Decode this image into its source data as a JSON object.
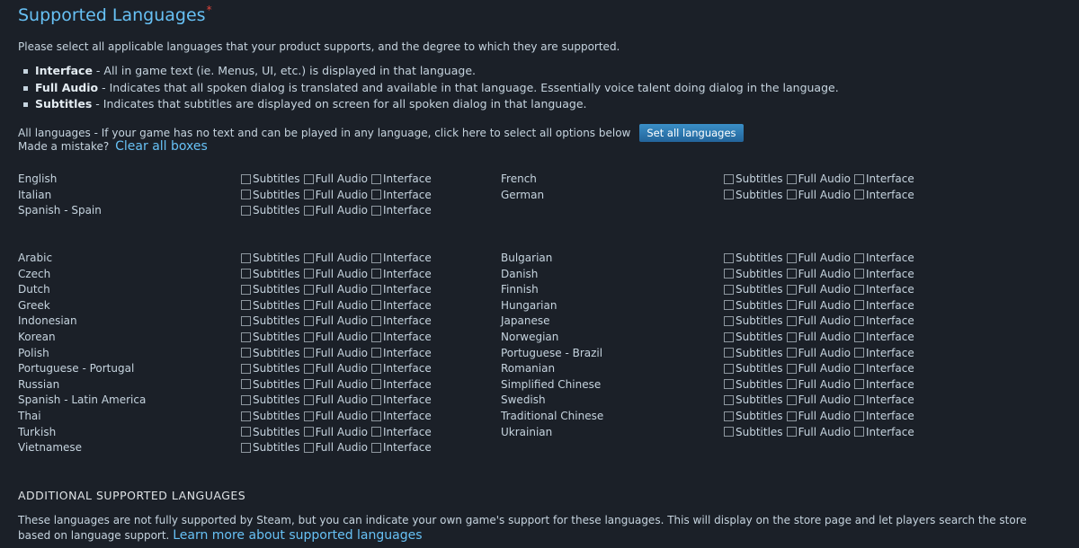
{
  "header": {
    "title": "Supported Languages",
    "required_mark": "*"
  },
  "intro": "Please select all applicable languages that your product supports, and the degree to which they are supported.",
  "bullets": [
    {
      "term": "Interface",
      "text": " - All in game text (ie. Menus, UI, etc.) is displayed in that language."
    },
    {
      "term": "Full Audio",
      "text": " - Indicates that all spoken dialog is translated and available in that language. Essentially voice talent doing dialog in the language."
    },
    {
      "term": "Subtitles",
      "text": " - Indicates that subtitles are displayed on screen for all spoken dialog in that language."
    }
  ],
  "all_languages_text": "All languages - If your game has no text and can be played in any language, click here to select all options below",
  "set_all_button": "Set all languages",
  "mistake_text": "Made a mistake?",
  "clear_all_link": "Clear all boxes",
  "option_labels": {
    "subtitles": "Subtitles",
    "full_audio": "Full Audio",
    "interface": "Interface"
  },
  "primary_languages": {
    "left": [
      "English",
      "Italian",
      "Spanish - Spain"
    ],
    "right": [
      "French",
      "German"
    ]
  },
  "other_languages": {
    "left": [
      "Arabic",
      "Czech",
      "Dutch",
      "Greek",
      "Indonesian",
      "Korean",
      "Polish",
      "Portuguese - Portugal",
      "Russian",
      "Spanish - Latin America",
      "Thai",
      "Turkish",
      "Vietnamese"
    ],
    "right": [
      "Bulgarian",
      "Danish",
      "Finnish",
      "Hungarian",
      "Japanese",
      "Norwegian",
      "Portuguese - Brazil",
      "Romanian",
      "Simplified Chinese",
      "Swedish",
      "Traditional Chinese",
      "Ukrainian"
    ]
  },
  "additional": {
    "heading": "ADDITIONAL SUPPORTED LANGUAGES",
    "text": "These languages are not fully supported by Steam, but you can indicate your own game's support for these languages. This will display on the store page and let players search the store based on language support.",
    "link": "Learn more about supported languages"
  }
}
